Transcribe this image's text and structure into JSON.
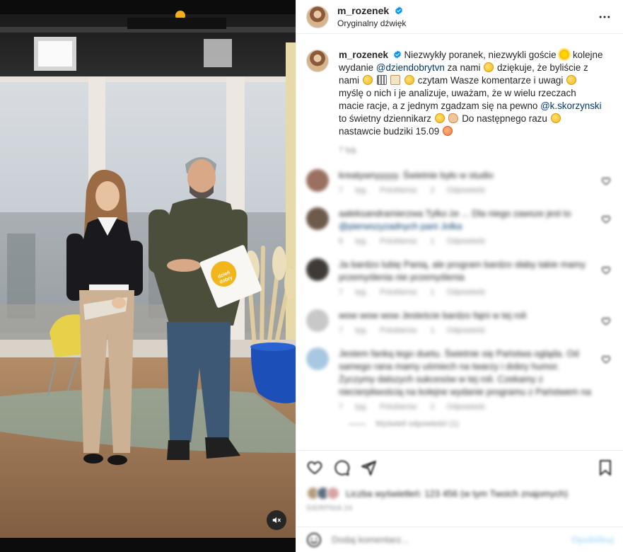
{
  "post": {
    "username": "m_rozenek",
    "audio": "Oryginalny dźwięk",
    "more_icon": "more-horizontal-icon"
  },
  "caption": {
    "username": "m_rozenek",
    "t1": "Niezwykły poranek, niezwykli goście",
    "t2": "kolejne wydanie",
    "mention1": "@dziendobrytvn",
    "t3": "za nami",
    "t4": "dziękuje, że byliście z nami",
    "t5": "czytam Wasze komentarze i uwagi",
    "t6": "myślę o nich i je analizuje, uważam, że w wielu rzeczach macie racje, a z jednym zgadzam się na pewno",
    "mention2": "@k.skorzynski",
    "t7": "to świetny dziennikarz",
    "t8": "Do następnego razu",
    "t9": "nastawcie budziki 15.09",
    "time": "7 tyg."
  },
  "comments": [
    {
      "avatar_color": "#9a7060",
      "text": "kreatywnyyyyy. Świetnie było w studio",
      "mention": "",
      "meta": [
        "7 tyg.",
        "Polubienia: 2",
        "Odpowiedz"
      ]
    },
    {
      "avatar_color": "#6d5a4a",
      "text": "aaleksandramierzwa Tylko że ... Dla niego zawsze jest to",
      "mention": "@pierwszyzadnych pani Jolka",
      "meta": [
        "6 tyg.",
        "Polubienia: 1",
        "Odpowiedz"
      ]
    },
    {
      "avatar_color": "#3f3a35",
      "text": "Ja bardzo lubię Panią, ale program bardzo słaby takie mamy przemyślenia nie przemyślenia",
      "mention": "",
      "meta": [
        "7 tyg.",
        "Polubienia: 1",
        "Odpowiedz"
      ]
    },
    {
      "avatar_color": "#c8c8c8",
      "text": "wow wow wow Jesteście bardzo fajni w tej roli",
      "mention": "",
      "meta": [
        "7 tyg.",
        "Polubienia: 1",
        "Odpowiedz"
      ]
    },
    {
      "avatar_color": "#a7c8e0",
      "text": "Jestem fanką tego duetu. Świetnie się Państwa ogląda. Od samego rana mamy uśmiech na twarzy i dobry humor. Życzymy dalszych sukcesów w tej roli. Czekamy z niecierpliwością na kolejne wydanie programu z Państwem na",
      "mention": "",
      "meta": [
        "7 tyg.",
        "Polubienia: 2",
        "Odpowiedz"
      ]
    }
  ],
  "replies_label": "Wyświetl odpowiedzi (1)",
  "actions": {
    "like_icon": "heart-icon",
    "comment_icon": "comment-icon",
    "share_icon": "share-icon",
    "save_icon": "bookmark-icon"
  },
  "likes": {
    "text": "Liczba wyświetleń: 123 456 (w tym Twoich znajomych)"
  },
  "date": "SIERPNIA 24",
  "add_comment": {
    "placeholder": "Dodaj komentarz...",
    "publish": "Opublikuj",
    "emoji_icon": "emoji-smiley-icon"
  },
  "video": {
    "mute_icon": "speaker-muted-icon",
    "card_text": "dzień dobry tvn"
  },
  "colors": {
    "link": "#00376b",
    "verified": "#0095f6",
    "muted_text": "#8e8e8e"
  }
}
